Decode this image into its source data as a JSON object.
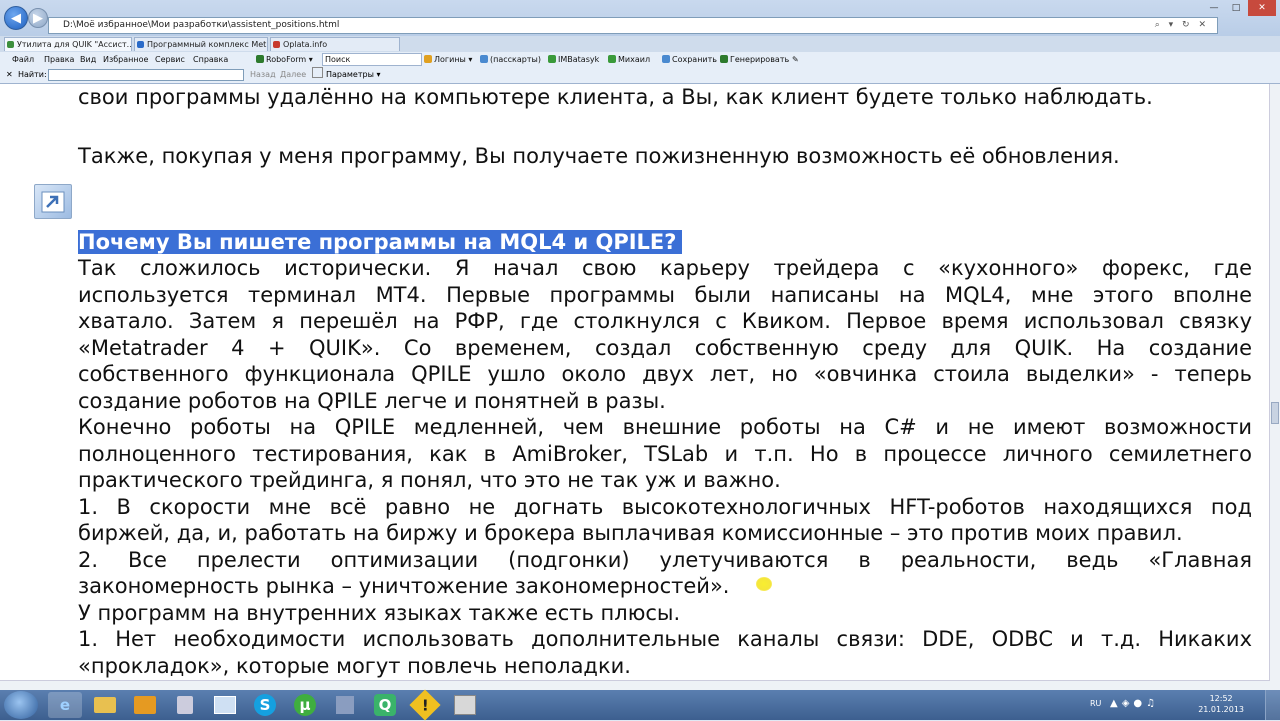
{
  "browser": {
    "address": "D:\\Моё избранное\\Мои разработки\\assistent_positions.html",
    "tabs": [
      "Утилита для QUIK \"Ассист...",
      "Программный комплекс Met...",
      "Oplata.info"
    ]
  },
  "menu": [
    "Файл",
    "Правка",
    "Вид",
    "Избранное",
    "Сервис",
    "Справка"
  ],
  "toolbar": {
    "roboform": "RoboForm",
    "search_placeholder": "Поиск",
    "logins": "Логины",
    "passcards": "(пасскарты)",
    "imbatsyk": "IMBatasyk",
    "mikhail": "Михаил",
    "save": "Сохранить",
    "generate": "Генерировать"
  },
  "findbar": {
    "label": "Найти:",
    "back": "Назад",
    "forward": "Далее",
    "params": "Параметры"
  },
  "article": {
    "line_top": "свои программы удалённо на компьютере клиента, а Вы, как клиент будете только наблюдать.",
    "para_update": "Также, покупая у меня программу, Вы получаете пожизненную возможность её обновления.",
    "heading": "Почему Вы пишете программы на MQL4 и QPILE?",
    "p1": [
      "Так сложилось исторически. Я начал свою карьеру трейдера с «кухонного» форекс, где",
      "используется терминал MT4. Первые программы были написаны на MQL4, мне этого вполне",
      "хватало. Затем я перешёл на РФР, где столкнулся с Квиком. Первое время использовал связку",
      "«Metatrader 4 + QUIK». Со временем, создал собственную среду для QUIK. На создание",
      "собственного функционала QPILE ушло около двух лет, но «овчинка стоила выделки» - теперь",
      "создание роботов на QPILE легче и понятней в разы."
    ],
    "p2": [
      "Конечно роботы на QPILE медленней, чем внешние роботы на C# и не имеют возможности",
      "полноценного тестирования, как в AmiBroker, TSLab и т.п. Но в процессе личного семилетнего",
      "практического трейдинга, я понял, что это не так уж и важно."
    ],
    "p3": [
      "1. В скорости мне всё равно не догнать высокотехнологичных HFT-роботов находящихся под",
      "биржей, да, и, работать на биржу и брокера выплачивая комиссионные – это против моих правил."
    ],
    "p4": [
      "2. Все прелести оптимизации (подгонки) улетучиваются в реальности, ведь «Главная",
      "закономерность рынка – уничтожение закономерностей»."
    ],
    "p5": "У программ на внутренних языках также есть плюсы.",
    "p6": [
      "1. Нет необходимости использовать дополнительные каналы связи: DDE, ODBC и т.д. Никаких",
      "«прокладок», которые могут повлечь неполадки."
    ]
  },
  "taskbar": {
    "lang": "RU",
    "time": "12:52",
    "date": "21.01.2013"
  },
  "colors": {
    "heading_bg": "#3b6fd6",
    "taskbar": "#3d5f8f"
  }
}
